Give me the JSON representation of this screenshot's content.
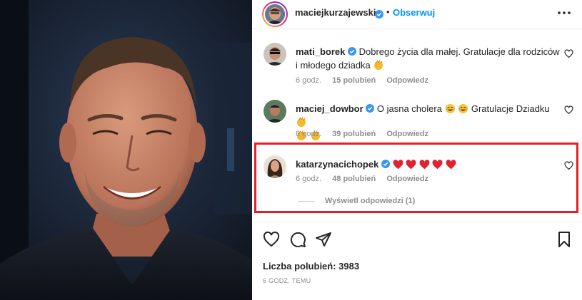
{
  "post": {
    "author": "maciejkurzajewski",
    "separator": "•",
    "follow_label": "Obserwuj",
    "likes_label": "Liczba polubień: 3983",
    "time_ago": "6 GODZ. TEMU"
  },
  "comments": [
    {
      "user": "mati_borek",
      "text": "Dobrego życia dla małej. Gratulacje dla rodziców i młodego dziadka",
      "time": "6 godz.",
      "likes": "15 polubień",
      "reply": "Odpowiedz"
    },
    {
      "user": "maciej_dowbor",
      "text": "O jasna cholera",
      "text2": "Gratulacje Dziadku",
      "time": "6 godz.",
      "likes": "39 polubień",
      "reply": "Odpowiedz"
    },
    {
      "user": "katarzynacichopek",
      "text": "",
      "time": "6 godz.",
      "likes": "48 polubień",
      "reply": "Odpowiedz",
      "view_replies": "Wyświetl odpowiedzi (1)"
    }
  ],
  "colors": {
    "accent": "#0095f6",
    "verified": "#3897f0",
    "highlight": "#e0202b",
    "muted": "#8e8e8e"
  },
  "icons": [
    "more-icon",
    "verified-icon",
    "heart-icon",
    "comment-icon",
    "share-icon",
    "bookmark-icon",
    "clap-emoji",
    "laugh-emoji",
    "red-heart-emoji"
  ]
}
